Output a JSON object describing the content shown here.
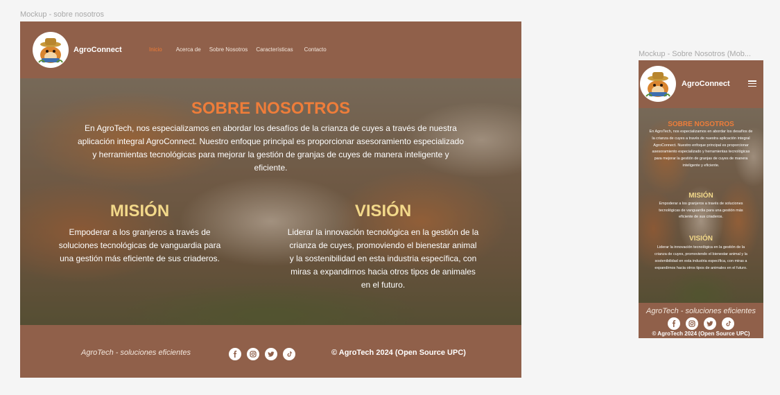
{
  "desktop": {
    "frame_label": "Mockup - sobre nosotros",
    "brand": "AgroConnect",
    "nav": [
      "Inicio",
      "Acerca de",
      "Sobre Nosotros",
      "Características",
      "Contacto"
    ],
    "about_title": "SOBRE NOSOTROS",
    "about_text": "En AgroTech, nos especializamos en abordar los desafíos de la crianza de cuyes a través de nuestra aplicación integral AgroConnect. Nuestro enfoque principal es proporcionar asesoramiento especializado y herramientas tecnológicas para mejorar la gestión de granjas de cuyes de manera inteligente y eficiente.",
    "mision_title": "MISIÓN",
    "mision_text": "Empoderar a los granjeros a través de soluciones tecnológicas de vanguardia para una gestión más eficiente de sus criaderos.",
    "vision_title": "VISIÓN",
    "vision_text": "Liderar la innovación tecnológica en la gestión de la crianza de cuyes, promoviendo el bienestar animal y la sostenibilidad en esta industria específica, con miras a expandirnos hacia otros tipos de animales en el futuro.",
    "footer_slogan": "AgroTech - soluciones eficientes",
    "footer_copyright": "© AgroTech 2024 (Open Source UPC)"
  },
  "mobile": {
    "frame_label": "Mockup - Sobre Nosotros (Mob...",
    "brand": "AgroConnect",
    "about_title": "SOBRE NOSOTROS",
    "about_text": "En AgroTech, nos especializamos en abordar los desafíos de la crianza de cuyes a través de nuestra aplicación integral AgroConnect. Nuestro enfoque principal es proporcionar asesoramiento especializado y herramientas tecnológicas para mejorar la gestión de granjas de cuyes de manera inteligente y eficiente.",
    "mision_title": "MISIÓN",
    "mision_text": "Empoderar a los granjeros a través de soluciones tecnológicas de vanguardia para una gestión más eficiente de sus criaderos.",
    "vision_title": "VISIÓN",
    "vision_text": "Liderar la innovación tecnológica en la gestión de la crianza de cuyes, promoviendo el bienestar animal y la sostenibilidad en esta industria específica, con miras a expandirnos hacia otros tipos de animales en el futuro.",
    "footer_slogan": "AgroTech - soluciones eficientes",
    "footer_copyright": "© AgroTech 2024 (Open Source UPC)"
  },
  "social_icons": [
    "facebook-icon",
    "instagram-icon",
    "twitter-icon",
    "tiktok-icon"
  ],
  "colors": {
    "brand_brown": "#90604a",
    "accent_orange": "#ee7d3a",
    "heading_yellow": "#f3d98a",
    "canvas": "#f5f5f5"
  }
}
